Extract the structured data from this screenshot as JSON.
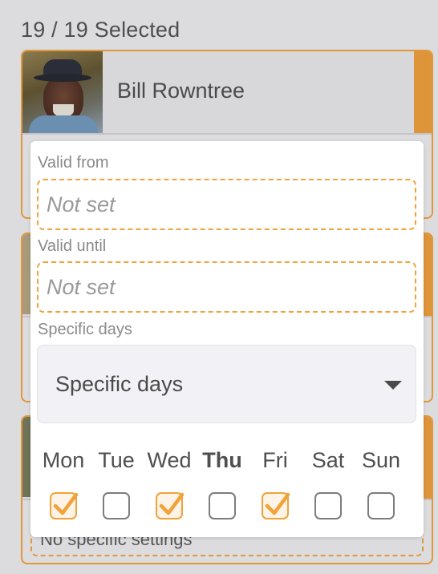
{
  "header": {
    "selection_count": "19 / 19 Selected"
  },
  "cards": [
    {
      "name": "Bill Rowntree"
    },
    {
      "name": ""
    },
    {
      "name": "",
      "setting_text": "No specific settings"
    }
  ],
  "panel": {
    "valid_from_label": "Valid from",
    "valid_from_value": "Not set",
    "valid_until_label": "Valid until",
    "valid_until_value": "Not set",
    "specific_days_label": "Specific days",
    "specific_days_selected": "Specific days",
    "days": [
      {
        "label": "Mon",
        "checked": true,
        "today": false
      },
      {
        "label": "Tue",
        "checked": false,
        "today": false
      },
      {
        "label": "Wed",
        "checked": true,
        "today": false
      },
      {
        "label": "Thu",
        "checked": false,
        "today": true
      },
      {
        "label": "Fri",
        "checked": true,
        "today": false
      },
      {
        "label": "Sat",
        "checked": false,
        "today": false
      },
      {
        "label": "Sun",
        "checked": false,
        "today": false
      }
    ]
  },
  "colors": {
    "accent": "#f0a33a",
    "card_border": "#e0983a",
    "background": "#dcdbde"
  }
}
